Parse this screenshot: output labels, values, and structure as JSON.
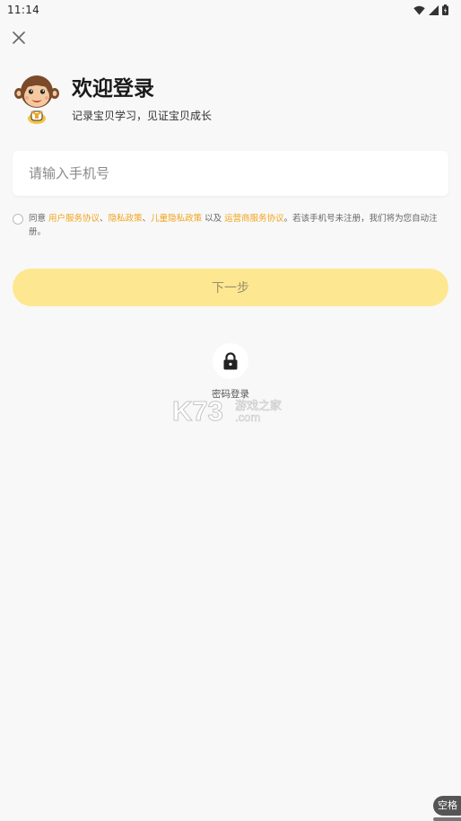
{
  "status_bar": {
    "time": "11:14",
    "icons": [
      "wifi-icon",
      "signal-icon",
      "battery-icon"
    ]
  },
  "header": {
    "close_icon": "close-icon",
    "title": "欢迎登录",
    "subtitle": "记录宝贝学习，见证宝贝成长"
  },
  "phone": {
    "placeholder": "请输入手机号",
    "value": ""
  },
  "agreement": {
    "prefix": "同意 ",
    "links": [
      "用户服务协议",
      "隐私政策",
      "儿童隐私政策",
      "运营商服务协议"
    ],
    "sep1": "、",
    "sep2": "、",
    "sep3": " 以及 ",
    "suffix": "。若该手机号未注册，我们将为您自动注册。",
    "checked": false
  },
  "next_button": {
    "label": "下一步"
  },
  "password_login": {
    "label": "密码登录",
    "icon": "lock-icon"
  },
  "watermark": {
    "brand": "K73",
    "site": "游戏之家",
    "domain": ".com"
  },
  "keyboard_hint": {
    "label": "空格"
  },
  "colors": {
    "accent": "#f2a41c",
    "button": "#fde891",
    "background": "#f8f8f8"
  }
}
